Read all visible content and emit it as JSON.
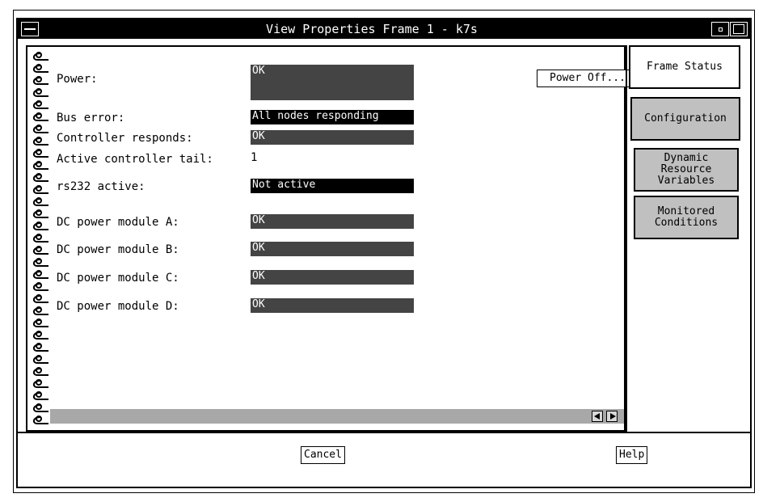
{
  "window": {
    "title": "View Properties Frame 1 - k7s"
  },
  "properties": {
    "power": {
      "label": "Power:",
      "value": "OK"
    },
    "power_off_button": "Power Off...",
    "bus_error": {
      "label": "Bus error:",
      "value": "All nodes responding"
    },
    "controller_responds": {
      "label": "Controller responds:",
      "value": "OK"
    },
    "active_controller_tail": {
      "label": "Active controller tail:",
      "value": "1"
    },
    "rs232_active": {
      "label": "rs232 active:",
      "value": "Not active"
    },
    "dc_module_a": {
      "label": "DC power module A:",
      "value": "OK"
    },
    "dc_module_b": {
      "label": "DC power module B:",
      "value": "OK"
    },
    "dc_module_c": {
      "label": "DC power module C:",
      "value": "OK"
    },
    "dc_module_d": {
      "label": "DC power module D:",
      "value": "OK"
    }
  },
  "tabs": [
    {
      "label": "Frame Status",
      "active": true
    },
    {
      "label": "Configuration",
      "active": false
    },
    {
      "label": "Dynamic\nResource\nVariables",
      "active": false
    },
    {
      "label": "Monitored\nConditions",
      "active": false
    }
  ],
  "buttons": {
    "cancel": "Cancel",
    "help": "Help"
  },
  "icons": {
    "window_menu": "window-menu-icon",
    "minimize": "minimize-icon",
    "maximize": "maximize-icon",
    "spiral": "spiral-binding",
    "scroll_left": "arrow-left-icon",
    "scroll_right": "arrow-right-icon"
  },
  "colors": {
    "value_gray": "#444444",
    "value_black": "#000000",
    "tab_inactive": "#c0c0c0",
    "scrollbar": "#a8a8a8"
  }
}
